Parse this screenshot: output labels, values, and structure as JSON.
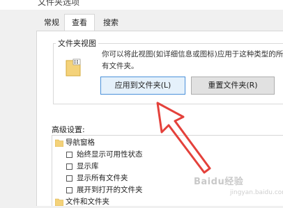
{
  "window": {
    "title": "文件夹选项"
  },
  "tabs": [
    {
      "label": "常规"
    },
    {
      "label": "查看"
    },
    {
      "label": "搜索"
    }
  ],
  "folder_views": {
    "label": "文件夹视图",
    "description_line1": "你可以将此视图(如详细信息或图标)应用于这种类型的所",
    "description_line2": "有文件夹。",
    "apply_button": "应用到文件夹(L)",
    "reset_button": "重置文件夹(R)"
  },
  "advanced": {
    "label": "高级设置:",
    "items": [
      {
        "label": "导航窗格",
        "type": "folder"
      },
      {
        "label": "始终显示可用性状态",
        "type": "checkbox",
        "checked": false
      },
      {
        "label": "显示库",
        "type": "checkbox",
        "checked": false
      },
      {
        "label": "显示所有文件夹",
        "type": "checkbox",
        "checked": false
      },
      {
        "label": "展开到打开的文件夹",
        "type": "checkbox",
        "checked": false
      },
      {
        "label": "文件和文件夹",
        "type": "folder"
      }
    ]
  },
  "watermark": {
    "brand": "Baidu经验",
    "sub": "jingyan.baidu.com"
  },
  "colors": {
    "arrow": "#e4413b",
    "accent_border": "#4a90d9",
    "folder": "#f4d27a"
  }
}
